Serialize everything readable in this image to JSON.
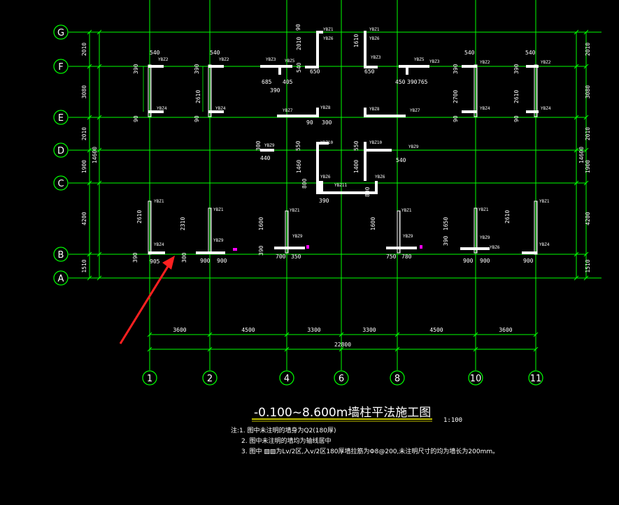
{
  "colors": {
    "grid": "#00ff00",
    "wall": "#ffffff",
    "arrow": "#ff2020",
    "underline": "#ffff00",
    "accent": "#ff00ff"
  },
  "row_axes": [
    "G",
    "F",
    "E",
    "D",
    "C",
    "B",
    "A"
  ],
  "col_axes": [
    "1",
    "2",
    "4",
    "6",
    "8",
    "10",
    "11"
  ],
  "left_dims": [
    "2010",
    "3080",
    "2010",
    "1900",
    "4200",
    "1510",
    "14600"
  ],
  "right_dims": [
    "2010",
    "3080",
    "2010",
    "1900",
    "4200",
    "1510",
    "14600"
  ],
  "bottom_dims": [
    "3600",
    "4500",
    "3300",
    "3300",
    "4500",
    "3600"
  ],
  "bottom_total": "22800",
  "wall_dims": {
    "w540a": "540",
    "w540b": "540",
    "w540c": "540",
    "w540d": "540",
    "w540e": "540",
    "w390a": "390",
    "w390b": "390",
    "w390c": "390",
    "w390d": "390",
    "w390e": "390",
    "w390f": "390",
    "w390g": "390",
    "w390h": "390",
    "w390i": "390",
    "w2610a": "2610",
    "w2610b": "2610",
    "w2610c": "2610",
    "w2610d": "2610",
    "w2700": "2700",
    "w90a": "90",
    "w90b": "90",
    "w90c": "90",
    "w90d": "90",
    "w90e": "90",
    "w685": "685",
    "w405": "405",
    "w450": "450",
    "w765": "765",
    "w650a": "650",
    "w650b": "650",
    "w2010a": "2010",
    "w1610": "1610",
    "w300a": "300",
    "w300b": "300",
    "w300c": "300",
    "w440": "440",
    "w550": "550",
    "w1460": "1460",
    "w1400": "1400",
    "w800a": "800",
    "w800b": "800",
    "w2310": "2310",
    "w1600a": "1600",
    "w1600b": "1600",
    "w1650": "1650",
    "w905": "905",
    "w900a": "900",
    "w900b": "900",
    "w900c": "900",
    "w900d": "900",
    "w900e": "900",
    "w700": "700",
    "w350": "350",
    "w750": "750",
    "w780": "780"
  },
  "title": "-0.100~8.600m墙柱平法施工图",
  "scale": "1:100",
  "notes": [
    "注:1. 图中未注明的墙身为Q2(180厚)",
    "2. 图中未注明的墙均为轴线居中",
    "3. 图中 ▨▨为Lv/2区,入v/2区180厚墙拉筋为Φ8@200,未注明尺寸的均为墙长为200mm。"
  ],
  "tags": [
    "YBZ1",
    "YBZ2",
    "YBZ3",
    "YBZ4",
    "YBZ5",
    "YBZ6",
    "YBZ7",
    "YBZ8",
    "YBZ9",
    "YBZ10",
    "YBZ11"
  ]
}
